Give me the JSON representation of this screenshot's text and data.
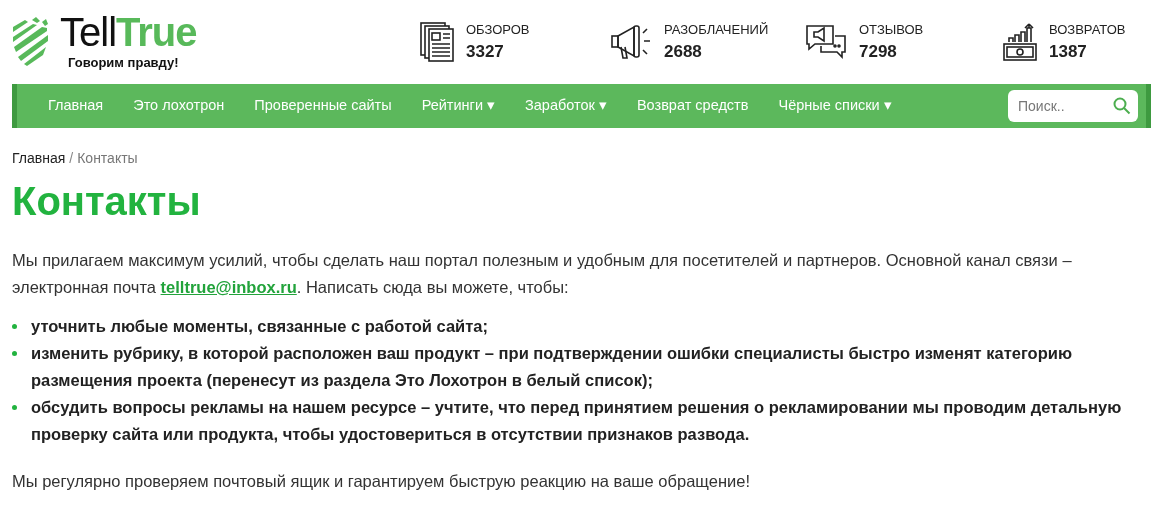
{
  "logo": {
    "brand_dark": "Tell",
    "brand_green": "True",
    "tagline": "Говорим правду!"
  },
  "stats": [
    {
      "kind": "newspaper",
      "label": "ОБЗОРОВ",
      "count": "3327"
    },
    {
      "kind": "megaphone",
      "label": "РАЗОБЛАЧЕНИЙ",
      "count": "2688"
    },
    {
      "kind": "chat",
      "label": "ОТЗЫВОВ",
      "count": "7298"
    },
    {
      "kind": "refund",
      "label": "ВОЗВРАТОВ",
      "count": "1387"
    }
  ],
  "nav": {
    "items": [
      {
        "label": "Главная",
        "dropdown": false
      },
      {
        "label": "Это лохотрон",
        "dropdown": false
      },
      {
        "label": "Проверенные сайты",
        "dropdown": false
      },
      {
        "label": "Рейтинги",
        "dropdown": true
      },
      {
        "label": "Заработок",
        "dropdown": true
      },
      {
        "label": "Возврат средств",
        "dropdown": false
      },
      {
        "label": "Чёрные списки",
        "dropdown": true
      }
    ],
    "dropdown_glyph": "▾",
    "search": {
      "placeholder": "Поиск.."
    }
  },
  "breadcrumb": {
    "link": "Главная",
    "separator": "/",
    "current": "Контакты"
  },
  "title": "Контакты",
  "intro": {
    "before": "Мы прилагаем максимум усилий, чтобы сделать наш портал полезным и удобным для посетителей и партнеров. Основной канал связи – электронная почта ",
    "email": "telltrue@inbox.ru",
    "after": ". Написать сюда вы можете, чтобы:"
  },
  "bullets": [
    "уточнить любые моменты, связанные с работой сайта;",
    "изменить рубрику, в которой расположен ваш продукт – при подтверждении ошибки специалисты быстро изменят категорию размещения проекта (перенесут из раздела Это Лохотрон в белый список);",
    "обсудить вопросы рекламы на нашем ресурсе – учтите, что перед принятием решения о рекламировании мы проводим детальную проверку сайта или продукта, чтобы удостовериться в отсутствии признаков развода."
  ],
  "closing": "Мы регулярно проверяем почтовый ящик и гарантируем быструю реакцию на ваше обращение!"
}
